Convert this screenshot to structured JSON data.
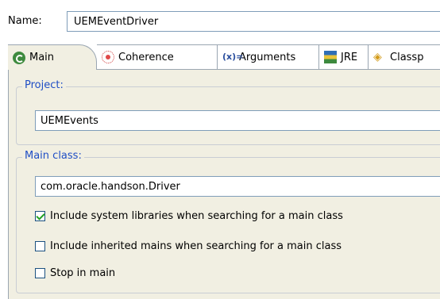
{
  "name_row": {
    "label": "Name:",
    "value": "UEMEventDriver"
  },
  "tabs": [
    {
      "label": "Main",
      "icon": "main-launch-icon",
      "active": true
    },
    {
      "label": "Coherence",
      "icon": "coherence-icon",
      "active": false
    },
    {
      "label": "Arguments",
      "icon": "arguments-icon",
      "icon_text": "(x)=",
      "active": false
    },
    {
      "label": "JRE",
      "icon": "jre-library-icon",
      "active": false
    },
    {
      "label": "Classp",
      "icon": "classpath-icon",
      "active": false
    }
  ],
  "project": {
    "title": "Project:",
    "value": "UEMEvents"
  },
  "main_class": {
    "title": "Main class:",
    "value": "com.oracle.handson.Driver"
  },
  "options": [
    {
      "label": "Include system libraries when searching for a main class",
      "checked": true
    },
    {
      "label": "Include inherited mains when searching for a main class",
      "checked": false
    },
    {
      "label": "Stop in main",
      "checked": false
    }
  ],
  "colors": {
    "panel_bg": "#f1efe2",
    "group_title": "#1f4ec5",
    "field_border": "#7f9db9",
    "check_mark": "#21a121"
  }
}
